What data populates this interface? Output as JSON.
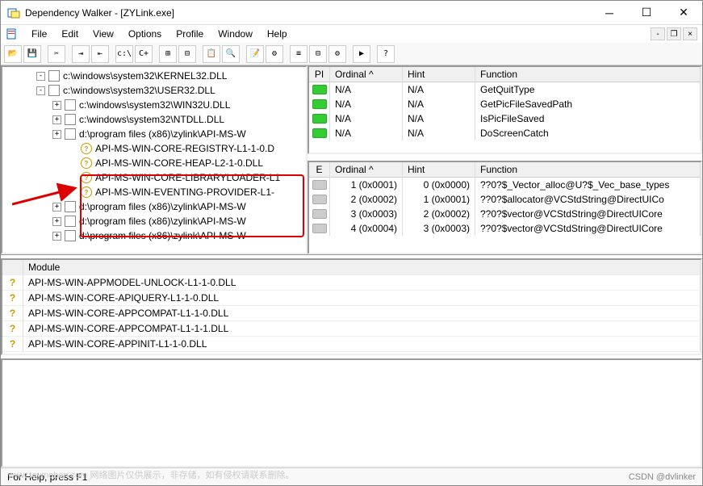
{
  "window": {
    "title": "Dependency Walker - [ZYLink.exe]"
  },
  "menu": {
    "file": "File",
    "edit": "Edit",
    "view": "View",
    "options": "Options",
    "profile": "Profile",
    "window": "Window",
    "help": "Help"
  },
  "toolbar_labels": {
    "open": "📂",
    "save": "💾",
    "cut": "✂",
    "h1": "⇥",
    "h2": "⇤",
    "cpath": "c:\\",
    "cpp": "C+",
    "expand": "⊞",
    "collapse": "⊟",
    "copy": "📋",
    "find": "🔍",
    "props": "📝",
    "sys": "⚙",
    "list": "≡",
    "tree": "⊟",
    "cfg": "⚙",
    "run": "▶",
    "help": "?"
  },
  "tree": {
    "rows": [
      {
        "indent": 40,
        "pm": "-",
        "ico": "dll",
        "text": "c:\\windows\\system32\\KERNEL32.DLL"
      },
      {
        "indent": 40,
        "pm": "-",
        "ico": "dll",
        "text": "c:\\windows\\system32\\USER32.DLL"
      },
      {
        "indent": 60,
        "pm": "+",
        "ico": "dll",
        "text": "c:\\windows\\system32\\WIN32U.DLL"
      },
      {
        "indent": 60,
        "pm": "+",
        "ico": "dll",
        "text": "c:\\windows\\system32\\NTDLL.DLL"
      },
      {
        "indent": 60,
        "pm": "+",
        "ico": "dll",
        "text": "d:\\program files (x86)\\zylink\\API-MS-W"
      },
      {
        "indent": 80,
        "pm": "",
        "ico": "warn",
        "text": "API-MS-WIN-CORE-REGISTRY-L1-1-0.D"
      },
      {
        "indent": 80,
        "pm": "",
        "ico": "warn",
        "text": "API-MS-WIN-CORE-HEAP-L2-1-0.DLL"
      },
      {
        "indent": 80,
        "pm": "",
        "ico": "warn",
        "text": "API-MS-WIN-CORE-LIBRARYLOADER-L1"
      },
      {
        "indent": 80,
        "pm": "",
        "ico": "warn",
        "text": "API-MS-WIN-EVENTING-PROVIDER-L1-"
      },
      {
        "indent": 60,
        "pm": "+",
        "ico": "dll",
        "text": "d:\\program files (x86)\\zylink\\API-MS-W"
      },
      {
        "indent": 60,
        "pm": "+",
        "ico": "dll",
        "text": "d:\\program files (x86)\\zylink\\API-MS-W"
      },
      {
        "indent": 60,
        "pm": "+",
        "ico": "dll",
        "text": "d:\\program files (x86)\\zylink\\API-MS-W"
      }
    ]
  },
  "imports": {
    "headers": {
      "pi": "PI",
      "ord": "Ordinal ^",
      "hint": "Hint",
      "func": "Function"
    },
    "rows": [
      {
        "badge": "green",
        "ord": "N/A",
        "hint": "N/A",
        "func": "GetQuitType"
      },
      {
        "badge": "green",
        "ord": "N/A",
        "hint": "N/A",
        "func": "GetPicFileSavedPath"
      },
      {
        "badge": "green",
        "ord": "N/A",
        "hint": "N/A",
        "func": "IsPicFileSaved"
      },
      {
        "badge": "green",
        "ord": "N/A",
        "hint": "N/A",
        "func": "DoScreenCatch"
      }
    ]
  },
  "exports": {
    "headers": {
      "e": "E",
      "ord": "Ordinal ^",
      "hint": "Hint",
      "func": "Function"
    },
    "rows": [
      {
        "badge": "gray",
        "ord": "1 (0x0001)",
        "hint": "0 (0x0000)",
        "func": "??0?$_Vector_alloc@U?$_Vec_base_types"
      },
      {
        "badge": "gray",
        "ord": "2 (0x0002)",
        "hint": "1 (0x0001)",
        "func": "??0?$allocator@VCStdString@DirectUICo"
      },
      {
        "badge": "gray",
        "ord": "3 (0x0003)",
        "hint": "2 (0x0002)",
        "func": "??0?$vector@VCStdString@DirectUICore"
      },
      {
        "badge": "gray",
        "ord": "4 (0x0004)",
        "hint": "3 (0x0003)",
        "func": "??0?$vector@VCStdString@DirectUICore"
      }
    ]
  },
  "modules": {
    "header": "Module",
    "rows": [
      {
        "text": "API-MS-WIN-APPMODEL-UNLOCK-L1-1-0.DLL"
      },
      {
        "text": "API-MS-WIN-CORE-APIQUERY-L1-1-0.DLL"
      },
      {
        "text": "API-MS-WIN-CORE-APPCOMPAT-L1-1-0.DLL"
      },
      {
        "text": "API-MS-WIN-CORE-APPCOMPAT-L1-1-1.DLL"
      },
      {
        "text": "API-MS-WIN-CORE-APPINIT-L1-1-0.DLL"
      }
    ]
  },
  "status": {
    "left": "For Help, press F1",
    "right": "CSDN @dvlinker"
  },
  "watermark": "www.toymoban.com 网络图片仅供展示，非存储，如有侵权请联系删除。"
}
